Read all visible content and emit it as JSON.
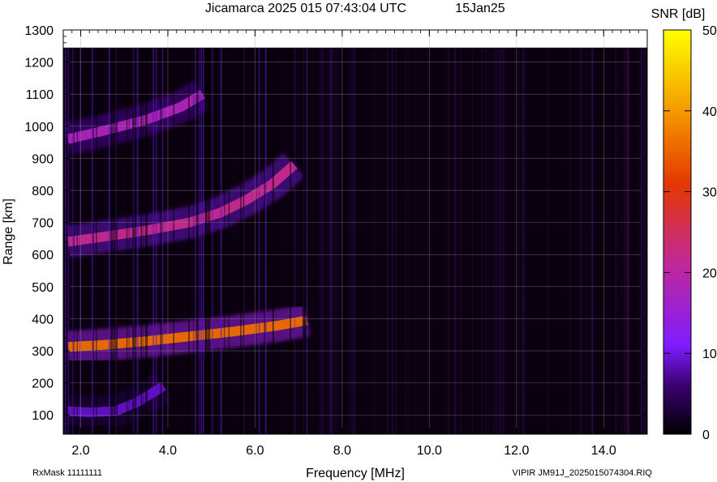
{
  "header": {
    "title": "Jicamarca 2025 015 07:43:04 UTC",
    "date": "15Jan25"
  },
  "footer": {
    "left": "RxMask 11111111",
    "right": "VIPIR  JM91J_2025015074304.RIQ"
  },
  "colorbar": {
    "title": "SNR [dB]",
    "ticks": [
      0,
      10,
      20,
      30,
      40,
      50
    ],
    "range": [
      0,
      50
    ],
    "colors": [
      "#000000",
      "#3a0070",
      "#7f1cff",
      "#c0289a",
      "#e43800",
      "#f49a00",
      "#ffff00"
    ]
  },
  "chart_data": {
    "type": "heatmap",
    "xlabel": "Frequency [MHz]",
    "ylabel": "Range [km]",
    "xlim": [
      1.6,
      15.0
    ],
    "ylim": [
      40,
      1300
    ],
    "data_range_top": 1245,
    "xticks": [
      {
        "v": 2.0,
        "label": "2.0"
      },
      {
        "v": 4.0,
        "label": "4.0"
      },
      {
        "v": 6.0,
        "label": "6.0"
      },
      {
        "v": 8.0,
        "label": "8.0"
      },
      {
        "v": 10.0,
        "label": "10.0"
      },
      {
        "v": 12.0,
        "label": "12.0"
      },
      {
        "v": 14.0,
        "label": "14.0"
      }
    ],
    "yticks": [
      {
        "v": 100,
        "label": "100"
      },
      {
        "v": 200,
        "label": "200"
      },
      {
        "v": 300,
        "label": "300"
      },
      {
        "v": 400,
        "label": "400"
      },
      {
        "v": 500,
        "label": "500"
      },
      {
        "v": 600,
        "label": "600"
      },
      {
        "v": 700,
        "label": "700"
      },
      {
        "v": 800,
        "label": "800"
      },
      {
        "v": 900,
        "label": "900"
      },
      {
        "v": 1000,
        "label": "1000"
      },
      {
        "v": 1100,
        "label": "1100"
      },
      {
        "v": 1200,
        "label": "1200"
      },
      {
        "v": 1300,
        "label": "1300"
      }
    ],
    "grid": true,
    "traces": [
      {
        "f": [
          1.7,
          2.5,
          3.5,
          4.5,
          5.5,
          6.5,
          7.2
        ],
        "h": [
          312,
          318,
          330,
          345,
          360,
          378,
          395
        ],
        "snr": 36
      },
      {
        "f": [
          1.7,
          2.5,
          3.5,
          4.5,
          5.2,
          5.8,
          6.4,
          6.9
        ],
        "h": [
          640,
          655,
          675,
          700,
          730,
          770,
          820,
          880
        ],
        "snr": 22
      },
      {
        "f": [
          1.7,
          2.5,
          3.5,
          4.3,
          4.8
        ],
        "h": [
          960,
          985,
          1020,
          1060,
          1100
        ],
        "snr": 18
      },
      {
        "f": [
          1.7,
          2.2,
          2.8,
          3.3,
          3.9
        ],
        "h": [
          112,
          108,
          112,
          140,
          190
        ],
        "snr": 9
      }
    ]
  }
}
